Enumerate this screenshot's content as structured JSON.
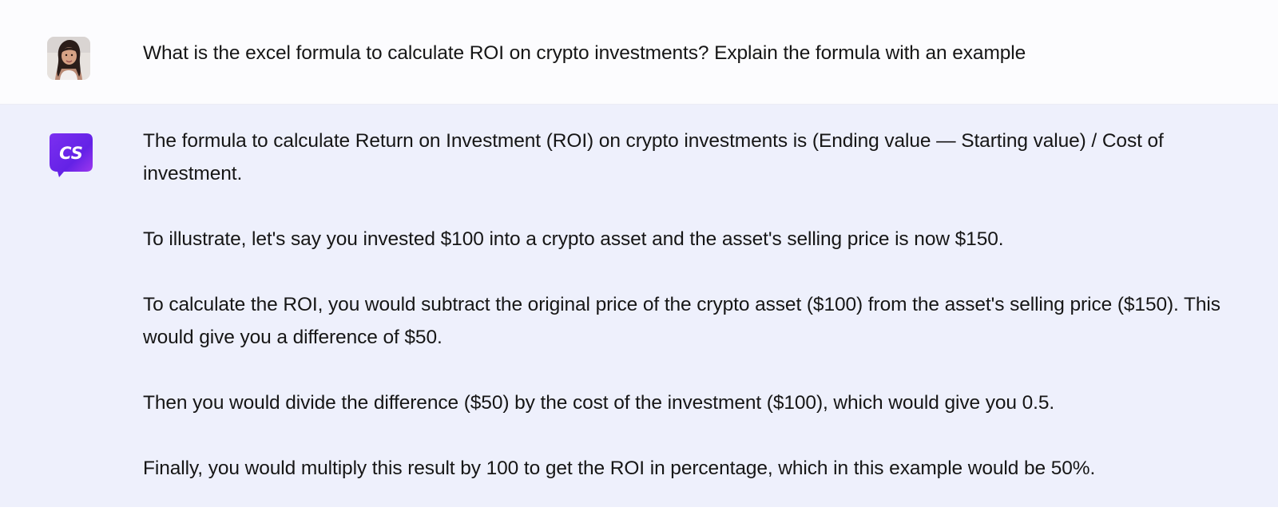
{
  "conversation": {
    "user_message": {
      "avatar_icon": "user-avatar-photo",
      "text": "What is the excel formula to calculate ROI on crypto investments? Explain the formula with an example"
    },
    "assistant_message": {
      "avatar_icon": "cs-logo-icon",
      "avatar_initials": "CS",
      "accent_color": "#6b21e8",
      "paragraphs": [
        "The formula to calculate Return on Investment (ROI) on crypto investments is (Ending value — Starting value) / Cost of investment.",
        "To illustrate, let's say you invested $100 into a crypto asset and the asset's selling price is now $150.",
        "To calculate the ROI, you would subtract the original price of the crypto asset ($100) from the asset's selling price ($150). This would give you a difference of $50.",
        "Then you would divide the difference ($50) by the cost of the investment ($100), which would give you 0.5.",
        "Finally, you would multiply this result by 100 to get the ROI in percentage, which in this example would be 50%."
      ]
    }
  },
  "colors": {
    "user_bg": "#fcfcfe",
    "assistant_bg": "#eef0fc",
    "text": "#161616"
  }
}
